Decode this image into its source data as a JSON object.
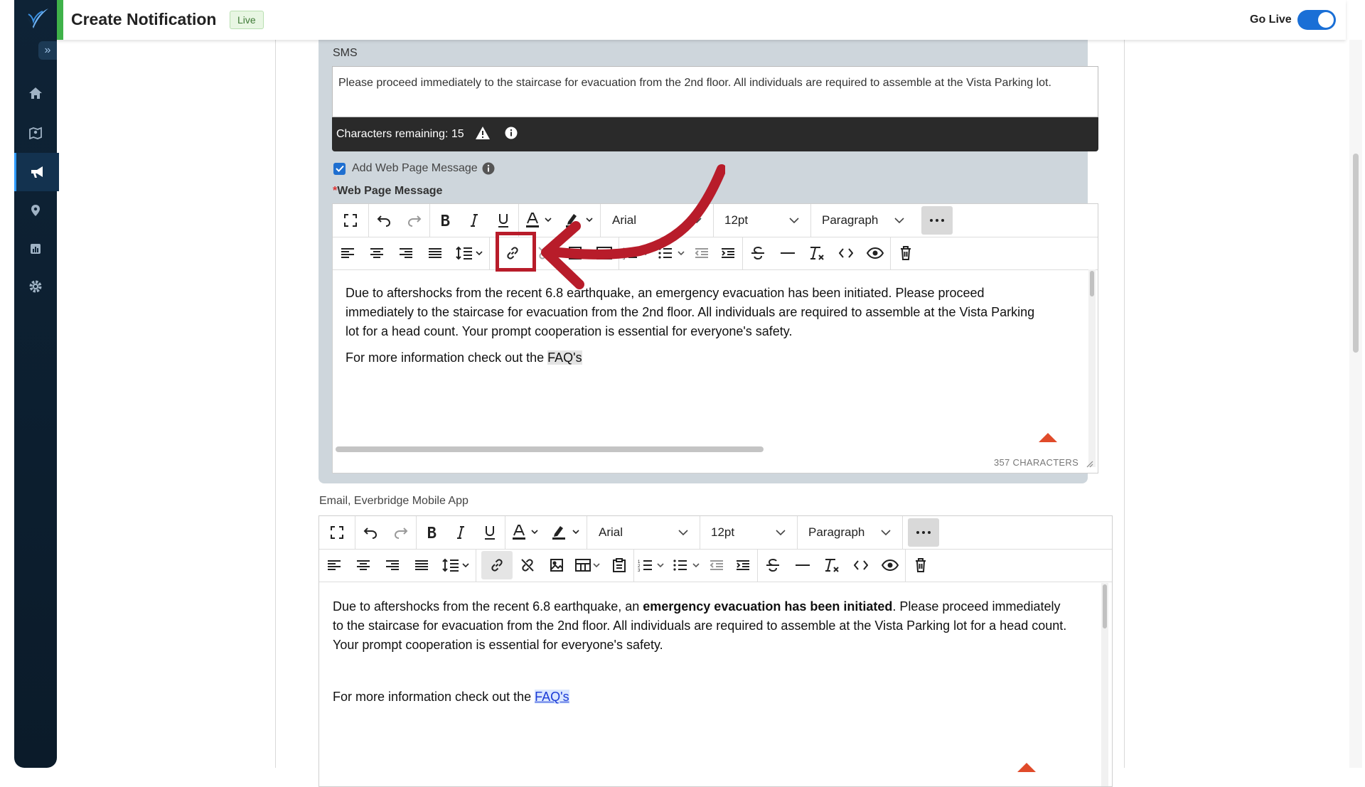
{
  "header": {
    "title": "Create Notification",
    "badge": "Live",
    "go_live_label": "Go Live",
    "go_live_on": true
  },
  "nav": {
    "items": [
      "home-icon",
      "map-icon",
      "megaphone-icon",
      "location-pin-icon",
      "reports-icon",
      "gear-icon"
    ],
    "active": "megaphone-icon"
  },
  "sms": {
    "label": "SMS",
    "text": "Please proceed immediately to the staircase for evacuation from the 2nd floor. All individuals are required to assemble at the Vista Parking lot.",
    "chars_remaining": "Characters remaining: 15"
  },
  "web": {
    "checkbox_label": "Add Web Page Message",
    "checked": true,
    "required_label": "Web Page Message",
    "font": "Arial",
    "size": "12pt",
    "block": "Paragraph",
    "body": "Due to aftershocks from the recent 6.8 earthquake, an emergency evacuation has been initiated. Please proceed immediately to the staircase for evacuation from the 2nd floor. All individuals are required to assemble at the Vista Parking lot for a head count. Your prompt cooperation is essential for everyone's safety.",
    "more_prefix": "For more information check out the ",
    "more_link": "FAQ's",
    "char_count": "357 CHARACTERS"
  },
  "email": {
    "label": "Email, Everbridge Mobile App",
    "font": "Arial",
    "size": "12pt",
    "block": "Paragraph",
    "body_pre": "Due to aftershocks from the recent 6.8 earthquake, an ",
    "body_bold": "emergency evacuation has been initiated",
    "body_post": ". Please proceed immediately to the staircase for evacuation from the 2nd floor. All individuals are required to assemble at the Vista Parking lot for a head count. Your prompt cooperation is essential for everyone's safety.",
    "more_prefix": "For more information check out the ",
    "more_link": "FAQ's"
  },
  "colors": {
    "accent": "#1a6fd6",
    "highlight": "#b81c2a",
    "sidebar": "#0e2336",
    "live_green": "#3fb24a"
  }
}
